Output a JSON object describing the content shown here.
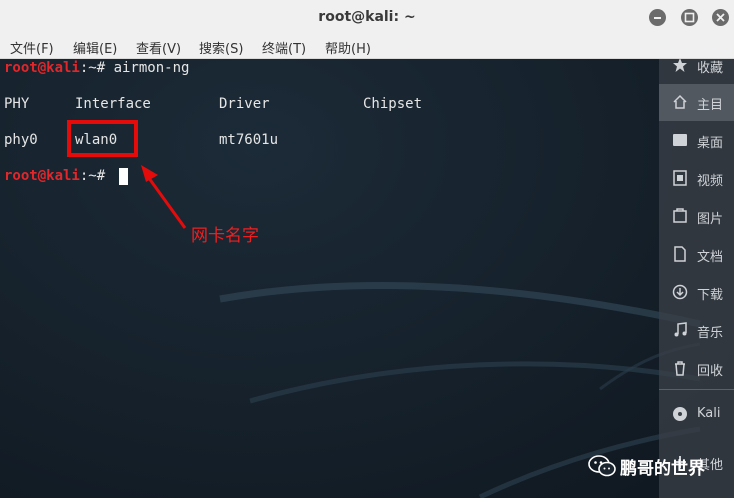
{
  "window": {
    "title": "root@kali: ~"
  },
  "menu": [
    "文件(F)",
    "编辑(E)",
    "查看(V)",
    "搜索(S)",
    "终端(T)",
    "帮助(H)"
  ],
  "terminal": {
    "prompt_user": "root@kali",
    "prompt_suffix": ":~# ",
    "command": "airmon-ng",
    "headers": [
      "PHY",
      "Interface",
      "Driver",
      "Chipset"
    ],
    "row": [
      "phy0",
      "wlan0",
      "mt7601u",
      ""
    ]
  },
  "annotation": {
    "text": "网卡名字",
    "color": "#e50b0b"
  },
  "side_panel": {
    "items": [
      {
        "label": "收藏",
        "icon": "star-icon"
      },
      {
        "label": "主目",
        "icon": "home-icon"
      },
      {
        "label": "桌面",
        "icon": "desktop-icon"
      },
      {
        "label": "视频",
        "icon": "video-icon"
      },
      {
        "label": "图片",
        "icon": "image-icon"
      },
      {
        "label": "文档",
        "icon": "document-icon"
      },
      {
        "label": "下载",
        "icon": "download-icon"
      },
      {
        "label": "音乐",
        "icon": "music-icon"
      },
      {
        "label": "回收",
        "icon": "trash-icon"
      },
      {
        "label": "Kali",
        "icon": "disc-icon"
      },
      {
        "label": "其他",
        "icon": "plus-icon"
      }
    ]
  },
  "watermark": {
    "text": "鹏哥的世界",
    "icon": "wechat-icon"
  }
}
